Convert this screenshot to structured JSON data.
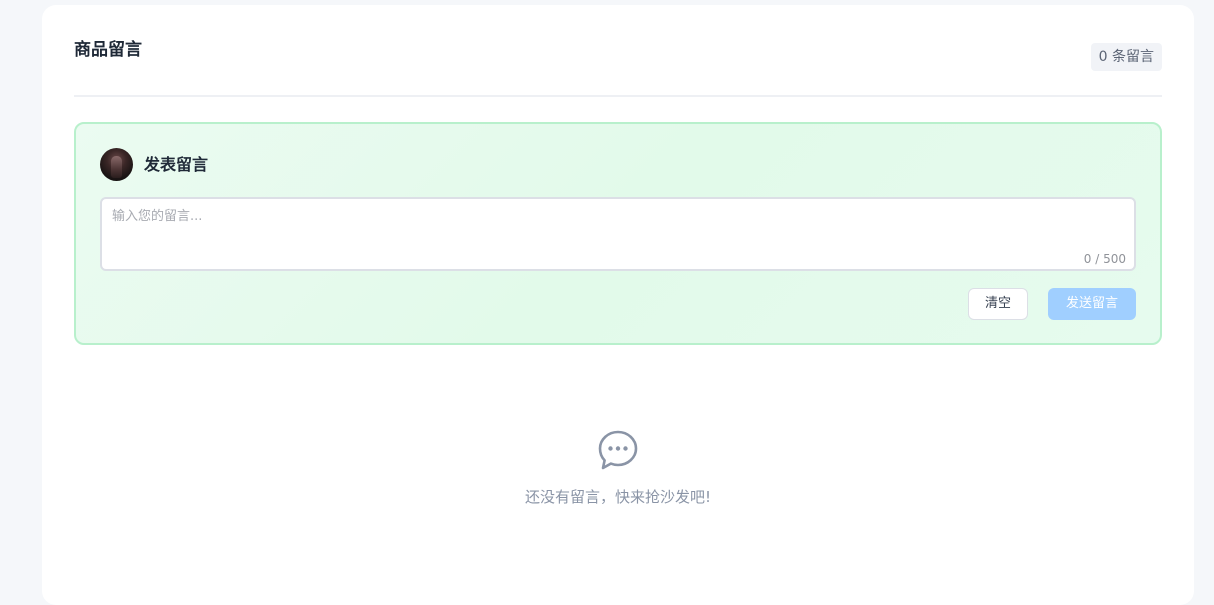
{
  "header": {
    "title": "商品留言",
    "count_label": "0 条留言"
  },
  "compose": {
    "title": "发表留言",
    "placeholder": "输入您的留言...",
    "value": "",
    "char_count": "0 / 500",
    "clear_label": "清空",
    "send_label": "发送留言"
  },
  "empty": {
    "icon": "chat-bubble-icon",
    "message": "还没有留言，快来抢沙发吧!"
  },
  "colors": {
    "compose_border": "#b8f0cc",
    "compose_bg": "#e6fbee",
    "send_button_bg": "#a0cfff",
    "empty_icon": "#8a94a6"
  }
}
